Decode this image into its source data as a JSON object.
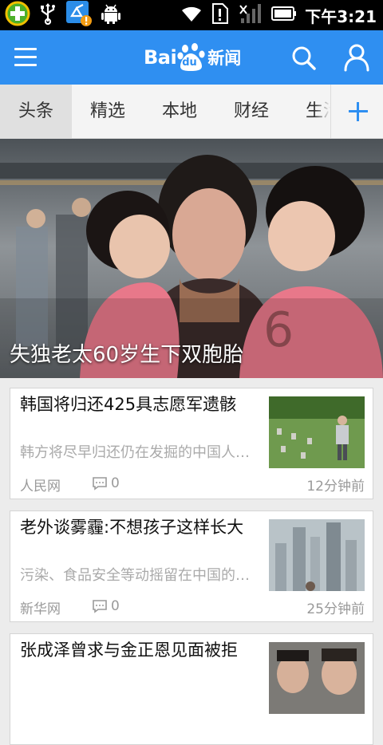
{
  "status_bar": {
    "time": "下午3:21",
    "icons": [
      "app-icon",
      "usb-icon",
      "sync-alert-icon",
      "android-debug-icon",
      "wifi-icon",
      "sim-alert-icon",
      "signal-icon",
      "battery-icon"
    ]
  },
  "header": {
    "logo_bai": "Bai",
    "logo_du": "du",
    "logo_news": "新闻",
    "accent_color": "#2f8ff1",
    "icons": [
      "menu-icon",
      "search-icon",
      "user-icon"
    ]
  },
  "tabs": {
    "items": [
      "头条",
      "精选",
      "本地",
      "财经",
      "生活"
    ],
    "active_index": 0
  },
  "hero": {
    "caption": "失独老太60岁生下双胞胎"
  },
  "news": [
    {
      "title": "韩国将归还425具志愿军遗骸",
      "summary": "韩方将尽早归还仍在发掘的中国人民志愿军遗骸",
      "source": "人民网",
      "comments": "0",
      "time": "12分钟前"
    },
    {
      "title": "老外谈雾霾:不想孩子这样长大",
      "summary": "污染、食品安全等动摇留在中国的决心",
      "source": "新华网",
      "comments": "0",
      "time": "25分钟前"
    },
    {
      "title": "张成泽曾求与金正恩见面被拒",
      "summary": "",
      "source": "",
      "comments": "",
      "time": ""
    }
  ]
}
